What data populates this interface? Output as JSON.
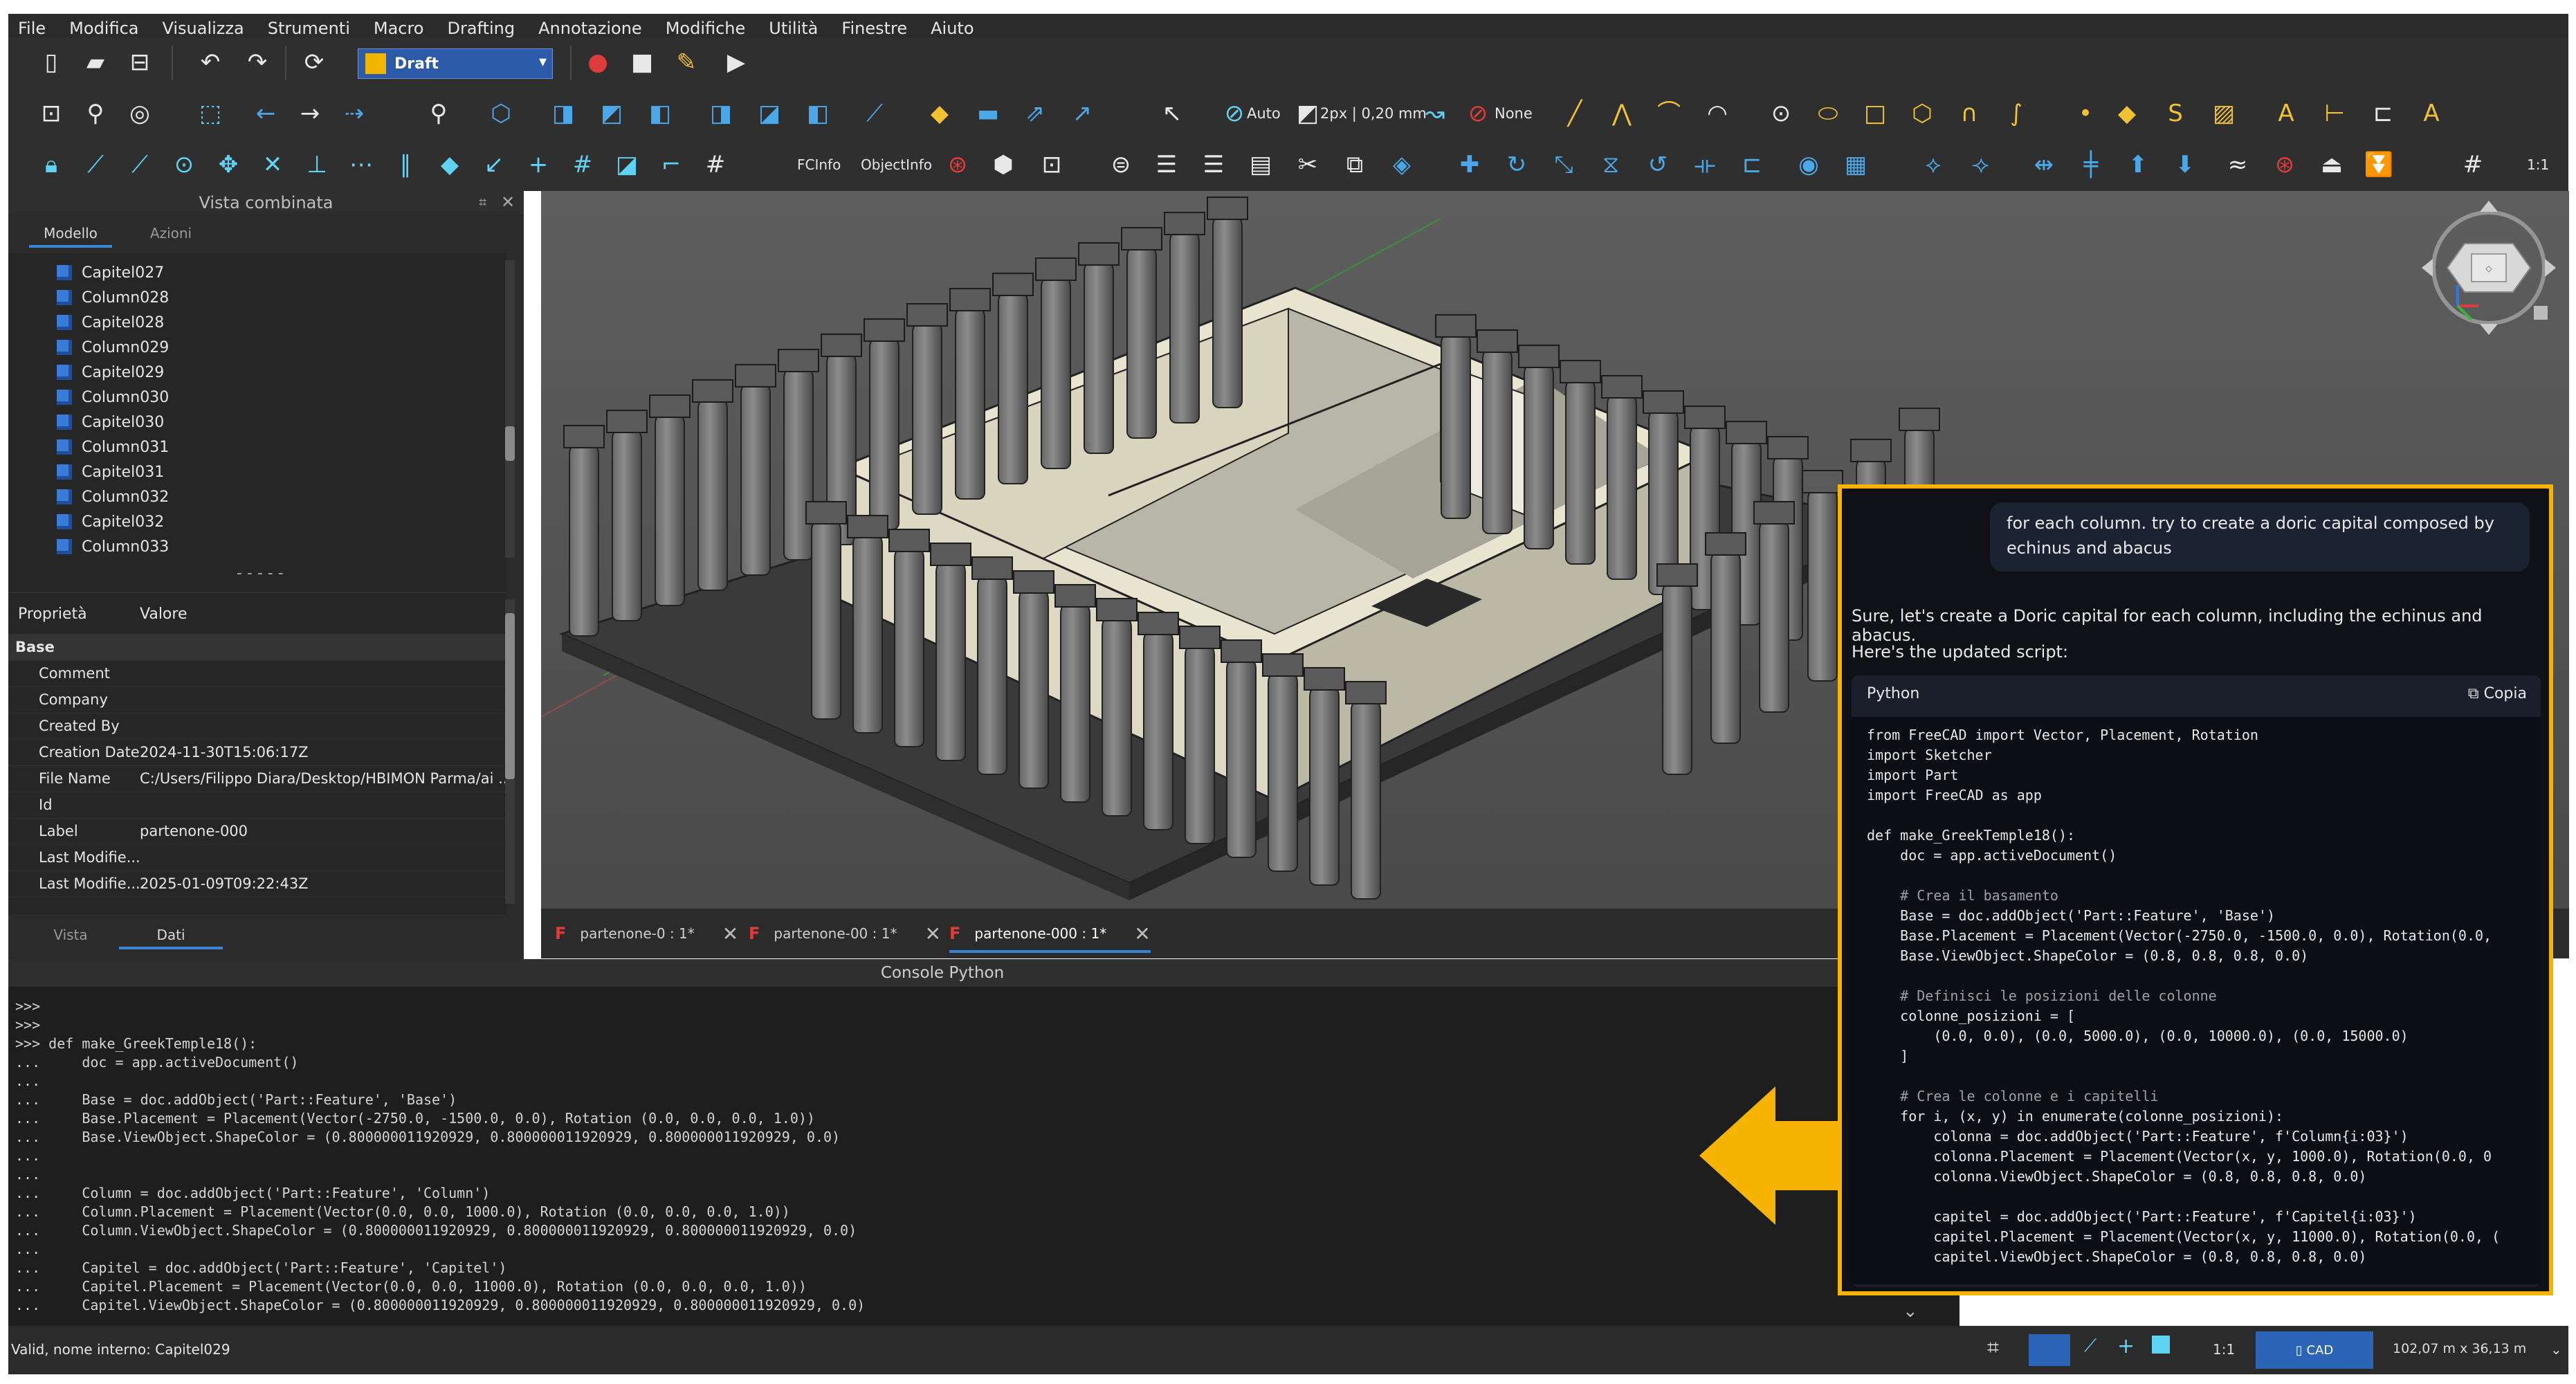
{
  "menubar": {
    "items": [
      "File",
      "Modifica",
      "Visualizza",
      "Strumenti",
      "Macro",
      "Drafting",
      "Annotazione",
      "Modifiche",
      "Utilità",
      "Finestre",
      "Aiuto"
    ]
  },
  "toolbar": {
    "workbench": "Draft",
    "snap_auto": "Auto",
    "line_width": "2px | 0,20 mm",
    "none_label": "None",
    "fcinfo": "FCInfo",
    "objectinfo": "ObjectInfo",
    "scale": "1:1"
  },
  "combo_view": {
    "title": "Vista combinata",
    "tabs": [
      "Modello",
      "Azioni"
    ],
    "tree_items": [
      "Capitel027",
      "Column028",
      "Capitel028",
      "Column029",
      "Capitel029",
      "Column030",
      "Capitel030",
      "Column031",
      "Capitel031",
      "Column032",
      "Capitel032",
      "Column033"
    ],
    "props_header": {
      "prop": "Proprietà",
      "value": "Valore"
    },
    "group": "Base",
    "properties": [
      {
        "k": "Comment",
        "v": ""
      },
      {
        "k": "Company",
        "v": ""
      },
      {
        "k": "Created By",
        "v": ""
      },
      {
        "k": "Creation Date",
        "v": "2024-11-30T15:06:17Z"
      },
      {
        "k": "File Name",
        "v": "C:/Users/Filippo Diara/Desktop/HBIMON Parma/ai ..."
      },
      {
        "k": "Id",
        "v": ""
      },
      {
        "k": "Label",
        "v": "partenone-000"
      },
      {
        "k": "Last Modifie...",
        "v": ""
      },
      {
        "k": "Last Modifie...",
        "v": "2025-01-09T09:22:43Z"
      }
    ],
    "bottom_tabs": [
      "Vista",
      "Dati"
    ]
  },
  "doc_tabs": [
    "partenone-0 : 1*",
    "partenone-00 : 1*",
    "partenone-000 : 1*"
  ],
  "console": {
    "title": "Console Python",
    "lines": [
      ">>>",
      ">>>",
      ">>> def make_GreekTemple18():",
      "...     doc = app.activeDocument()",
      "...",
      "...     Base = doc.addObject('Part::Feature', 'Base')",
      "...     Base.Placement = Placement(Vector(-2750.0, -1500.0, 0.0), Rotation (0.0, 0.0, 0.0, 1.0))",
      "...     Base.ViewObject.ShapeColor = (0.800000011920929, 0.800000011920929, 0.800000011920929, 0.0)",
      "...",
      "...",
      "...     Column = doc.addObject('Part::Feature', 'Column')",
      "...     Column.Placement = Placement(Vector(0.0, 0.0, 1000.0), Rotation (0.0, 0.0, 0.0, 1.0))",
      "...     Column.ViewObject.ShapeColor = (0.800000011920929, 0.800000011920929, 0.800000011920929, 0.0)",
      "...",
      "...     Capitel = doc.addObject('Part::Feature', 'Capitel')",
      "...     Capitel.Placement = Placement(Vector(0.0, 0.0, 11000.0), Rotation (0.0, 0.0, 0.0, 1.0))",
      "...     Capitel.ViewObject.ShapeColor = (0.800000011920929, 0.800000011920929, 0.800000011920929, 0.0)",
      "..."
    ]
  },
  "status": {
    "message": "Valid, nome interno: Capitel029",
    "scale": "1:1",
    "nav_style": "CAD",
    "dimensions": "102,07 m x 36,13 m"
  },
  "chat": {
    "user_message": "for each column. try to create a doric capital composed by echinus and abacus",
    "assistant_intro": "Sure, let's create a Doric capital for each column, including the echinus and abacus.",
    "assistant_line2": "Here's the updated script:",
    "code_lang": "Python",
    "copy_label": "Copia",
    "code_lines": [
      "from FreeCAD import Vector, Placement, Rotation",
      "import Sketcher",
      "import Part",
      "import FreeCAD as app",
      "",
      "def make_GreekTemple18():",
      "    doc = app.activeDocument()",
      "",
      "    # Crea il basamento",
      "    Base = doc.addObject('Part::Feature', 'Base')",
      "    Base.Placement = Placement(Vector(-2750.0, -1500.0, 0.0), Rotation(0.0,",
      "    Base.ViewObject.ShapeColor = (0.8, 0.8, 0.8, 0.0)",
      "",
      "    # Definisci le posizioni delle colonne",
      "    colonne_posizioni = [",
      "        (0.0, 0.0), (0.0, 5000.0), (0.0, 10000.0), (0.0, 15000.0)",
      "    ]",
      "",
      "    # Crea le colonne e i capitelli",
      "    for i, (x, y) in enumerate(colonne_posizioni):",
      "        colonna = doc.addObject('Part::Feature', f'Column{i:03}')",
      "        colonna.Placement = Placement(Vector(x, y, 1000.0), Rotation(0.0, 0",
      "        colonna.ViewObject.ShapeColor = (0.8, 0.8, 0.8, 0.0)",
      "",
      "        capitel = doc.addObject('Part::Feature', f'Capitel{i:03}')",
      "        capitel.Placement = Placement(Vector(x, y, 11000.0), Rotation(0.0, (",
      "        capitel.ViewObject.ShapeColor = (0.8, 0.8, 0.8, 0.0)"
    ]
  },
  "colors": {
    "accent": "#f6b400",
    "selection": "#3a84d4"
  }
}
